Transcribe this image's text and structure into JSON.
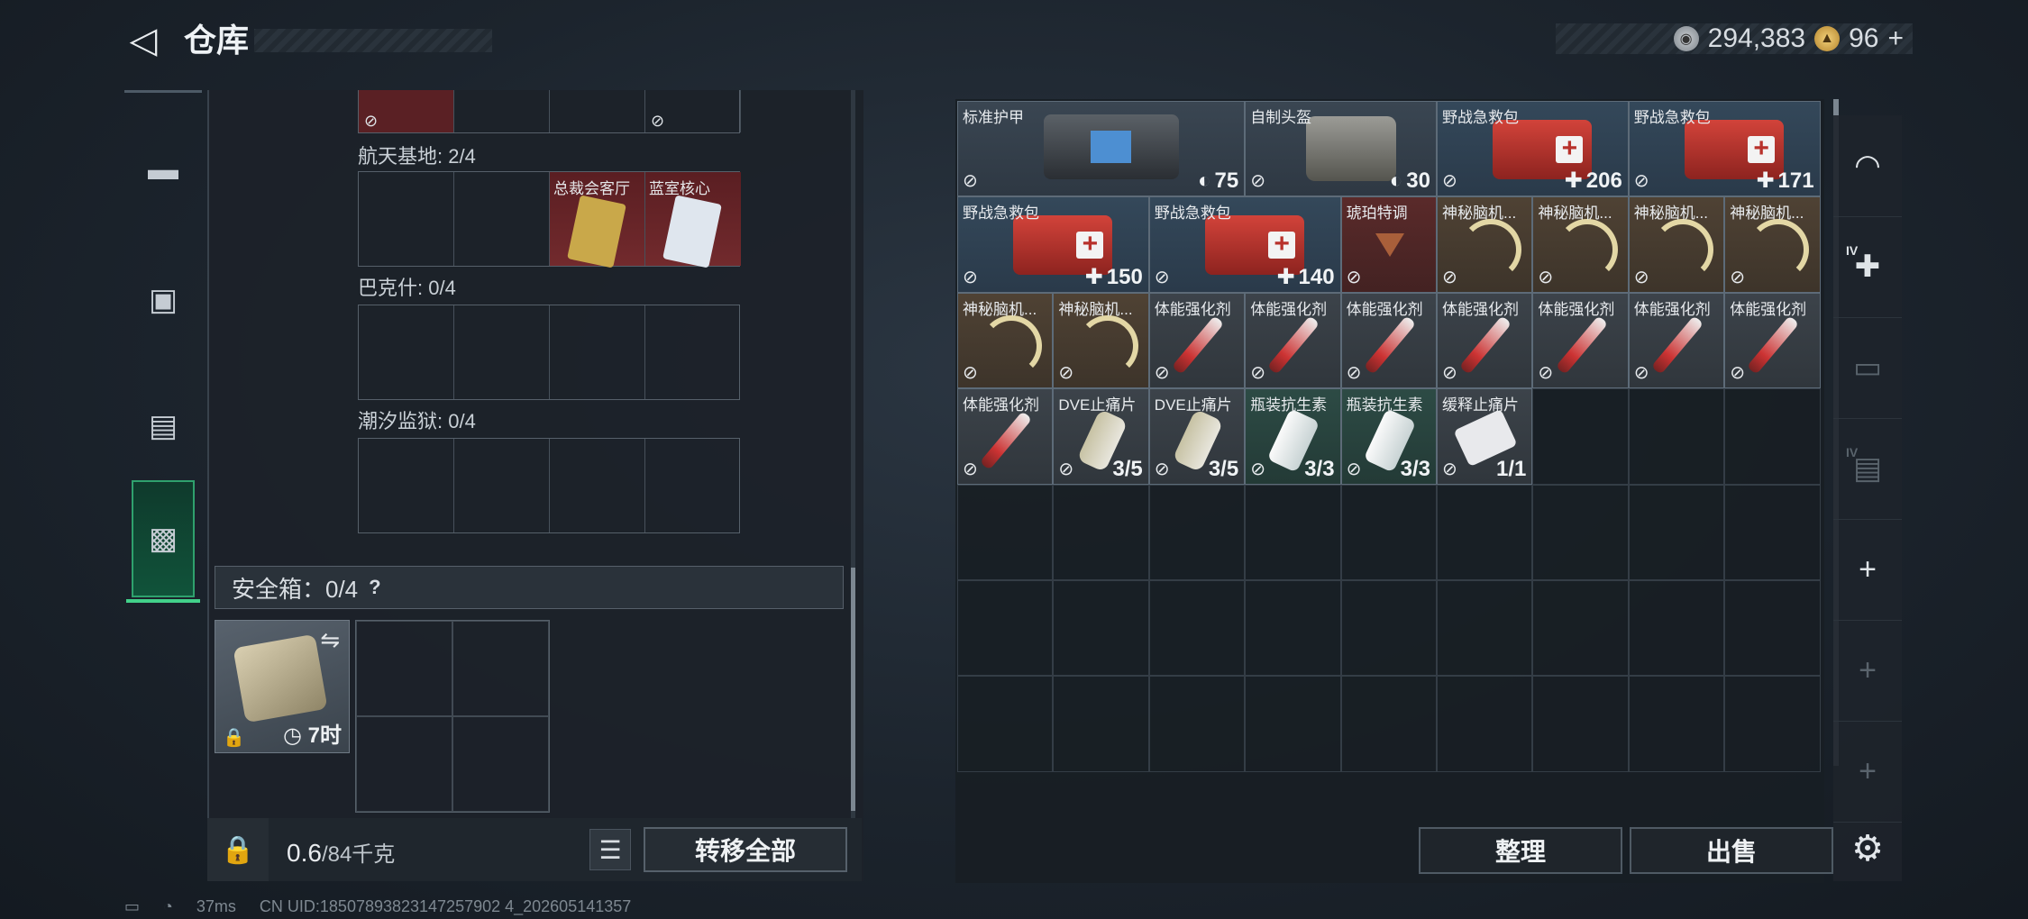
{
  "header": {
    "back_glyph": "◁",
    "title": "仓库",
    "currency": {
      "silver": "294,383",
      "gold": "96",
      "gold_plus": "+"
    }
  },
  "left_tabs": [
    {
      "id": "weapons",
      "icon": "pistol-icon",
      "glyph": "▬"
    },
    {
      "id": "armor",
      "icon": "backpack-icon",
      "glyph": "▣"
    },
    {
      "id": "gear",
      "icon": "vest-icon",
      "glyph": "▤"
    },
    {
      "id": "storage",
      "icon": "toolbox-icon",
      "glyph": "▩",
      "active": true
    }
  ],
  "stash": {
    "sections": [
      {
        "label": "航天基地: 2/4",
        "items": [
          {
            "name": ""
          },
          {
            "name": ""
          },
          {
            "name": "总裁会客厅",
            "card_color": "#c9a84a"
          },
          {
            "name": "蓝室核心",
            "card_color": "#dfe6ee"
          }
        ]
      },
      {
        "label": "巴克什: 0/4",
        "items": []
      },
      {
        "label": "潮汐监狱: 0/4",
        "items": []
      }
    ],
    "no_enter_glyph": "⊘"
  },
  "safe_box": {
    "label": "安全箱：0/4",
    "help": "?",
    "timer": "7时",
    "swap_glyph": "⇋",
    "lock_glyph": "🔒"
  },
  "weight": {
    "current": "0.6",
    "max": "/84千克"
  },
  "buttons": {
    "list_glyph": "☰",
    "transfer_all": "转移全部",
    "tidy": "整理",
    "sell": "出售"
  },
  "inventory": {
    "items": [
      {
        "name": "标准护甲",
        "type": "bag",
        "bg": "gray",
        "value": "75",
        "prefix": "◐",
        "col": 0,
        "row": 0,
        "w": 3,
        "h": 1
      },
      {
        "name": "自制头盔",
        "type": "helmet",
        "bg": "gray",
        "value": "30",
        "prefix": "◐",
        "col": 3,
        "row": 0,
        "w": 2,
        "h": 1
      },
      {
        "name": "野战急救包",
        "type": "medkit",
        "bg": "blue",
        "value": "206",
        "prefix": "✚",
        "col": 5,
        "row": 0,
        "w": 2,
        "h": 1
      },
      {
        "name": "野战急救包",
        "type": "medkit",
        "bg": "blue",
        "value": "171",
        "prefix": "✚",
        "col": 7,
        "row": 0,
        "w": 2,
        "h": 1
      },
      {
        "name": "野战急救包",
        "type": "medkit",
        "bg": "blue",
        "value": "150",
        "prefix": "✚",
        "col": 0,
        "row": 1,
        "w": 2,
        "h": 1
      },
      {
        "name": "野战急救包",
        "type": "medkit",
        "bg": "blue",
        "value": "140",
        "prefix": "✚",
        "col": 2,
        "row": 1,
        "w": 2,
        "h": 1
      },
      {
        "name": "琥珀特调",
        "type": "glass",
        "bg": "red",
        "value": "",
        "prefix": "",
        "col": 4,
        "row": 1,
        "w": 1,
        "h": 1
      },
      {
        "name": "神秘脑机...",
        "type": "neuro",
        "bg": "brown",
        "value": "",
        "prefix": "",
        "col": 5,
        "row": 1,
        "w": 1,
        "h": 1
      },
      {
        "name": "神秘脑机...",
        "type": "neuro",
        "bg": "brown",
        "value": "",
        "prefix": "",
        "col": 6,
        "row": 1,
        "w": 1,
        "h": 1
      },
      {
        "name": "神秘脑机...",
        "type": "neuro",
        "bg": "brown",
        "value": "",
        "prefix": "",
        "col": 7,
        "row": 1,
        "w": 1,
        "h": 1
      },
      {
        "name": "神秘脑机...",
        "type": "neuro",
        "bg": "brown",
        "value": "",
        "prefix": "",
        "col": 8,
        "row": 1,
        "w": 1,
        "h": 1
      },
      {
        "name": "神秘脑机...",
        "type": "neuro",
        "bg": "brown",
        "value": "",
        "prefix": "",
        "col": 0,
        "row": 2,
        "w": 1,
        "h": 1
      },
      {
        "name": "神秘脑机...",
        "type": "neuro",
        "bg": "brown",
        "value": "",
        "prefix": "",
        "col": 1,
        "row": 2,
        "w": 1,
        "h": 1
      },
      {
        "name": "体能强化剂",
        "type": "syringe",
        "bg": "gray2",
        "value": "",
        "prefix": "",
        "col": 2,
        "row": 2,
        "w": 1,
        "h": 1
      },
      {
        "name": "体能强化剂",
        "type": "syringe",
        "bg": "gray2",
        "value": "",
        "prefix": "",
        "col": 3,
        "row": 2,
        "w": 1,
        "h": 1
      },
      {
        "name": "体能强化剂",
        "type": "syringe",
        "bg": "gray2",
        "value": "",
        "prefix": "",
        "col": 4,
        "row": 2,
        "w": 1,
        "h": 1
      },
      {
        "name": "体能强化剂",
        "type": "syringe",
        "bg": "gray2",
        "value": "",
        "prefix": "",
        "col": 5,
        "row": 2,
        "w": 1,
        "h": 1
      },
      {
        "name": "体能强化剂",
        "type": "syringe",
        "bg": "gray2",
        "value": "",
        "prefix": "",
        "col": 6,
        "row": 2,
        "w": 1,
        "h": 1
      },
      {
        "name": "体能强化剂",
        "type": "syringe",
        "bg": "gray2",
        "value": "",
        "prefix": "",
        "col": 7,
        "row": 2,
        "w": 1,
        "h": 1
      },
      {
        "name": "体能强化剂",
        "type": "syringe",
        "bg": "gray2",
        "value": "",
        "prefix": "",
        "col": 8,
        "row": 2,
        "w": 1,
        "h": 1
      },
      {
        "name": "体能强化剂",
        "type": "syringe",
        "bg": "gray2",
        "value": "",
        "prefix": "",
        "col": 0,
        "row": 3,
        "w": 1,
        "h": 1
      },
      {
        "name": "DVE止痛片",
        "type": "pill",
        "bg": "gray2",
        "value": "3/5",
        "prefix": "",
        "col": 1,
        "row": 3,
        "w": 1,
        "h": 1
      },
      {
        "name": "DVE止痛片",
        "type": "pill",
        "bg": "gray2",
        "value": "3/5",
        "prefix": "",
        "col": 2,
        "row": 3,
        "w": 1,
        "h": 1
      },
      {
        "name": "瓶装抗生素",
        "type": "bottle",
        "bg": "teal",
        "value": "3/3",
        "prefix": "",
        "col": 3,
        "row": 3,
        "w": 1,
        "h": 1
      },
      {
        "name": "瓶装抗生素",
        "type": "bottle",
        "bg": "teal",
        "value": "3/3",
        "prefix": "",
        "col": 4,
        "row": 3,
        "w": 1,
        "h": 1
      },
      {
        "name": "缓释止痛片",
        "type": "blister",
        "bg": "gray2",
        "value": "1/1",
        "prefix": "",
        "col": 5,
        "row": 3,
        "w": 1,
        "h": 1,
        "no_enter": false
      }
    ],
    "no_enter_glyph": "⊘"
  },
  "right_tabs": [
    {
      "icon": "helmet-tab-icon",
      "glyph": "◠",
      "dim": false
    },
    {
      "icon": "medic-kit-tab-icon",
      "glyph": "✚",
      "dim": false,
      "label": "IV"
    },
    {
      "icon": "rifle-tab-icon",
      "glyph": "▭",
      "dim": true
    },
    {
      "icon": "folder-tab-icon",
      "glyph": "▤",
      "dim": true,
      "label": "IV"
    },
    {
      "icon": "add-tab-icon",
      "glyph": "+",
      "dim": false
    },
    {
      "icon": "add-tab-icon",
      "glyph": "+",
      "dim": true
    },
    {
      "icon": "add-tab-icon",
      "glyph": "+",
      "dim": true
    }
  ],
  "settings_glyph": "⚙",
  "footer": {
    "battery": "▭",
    "wifi": "◔",
    "ping": "37ms",
    "uid": "CN UID:18507893823147257902 4_202605141357"
  },
  "colors": {
    "accent_green": "#42d18a",
    "stash_red": "#722a2d"
  }
}
